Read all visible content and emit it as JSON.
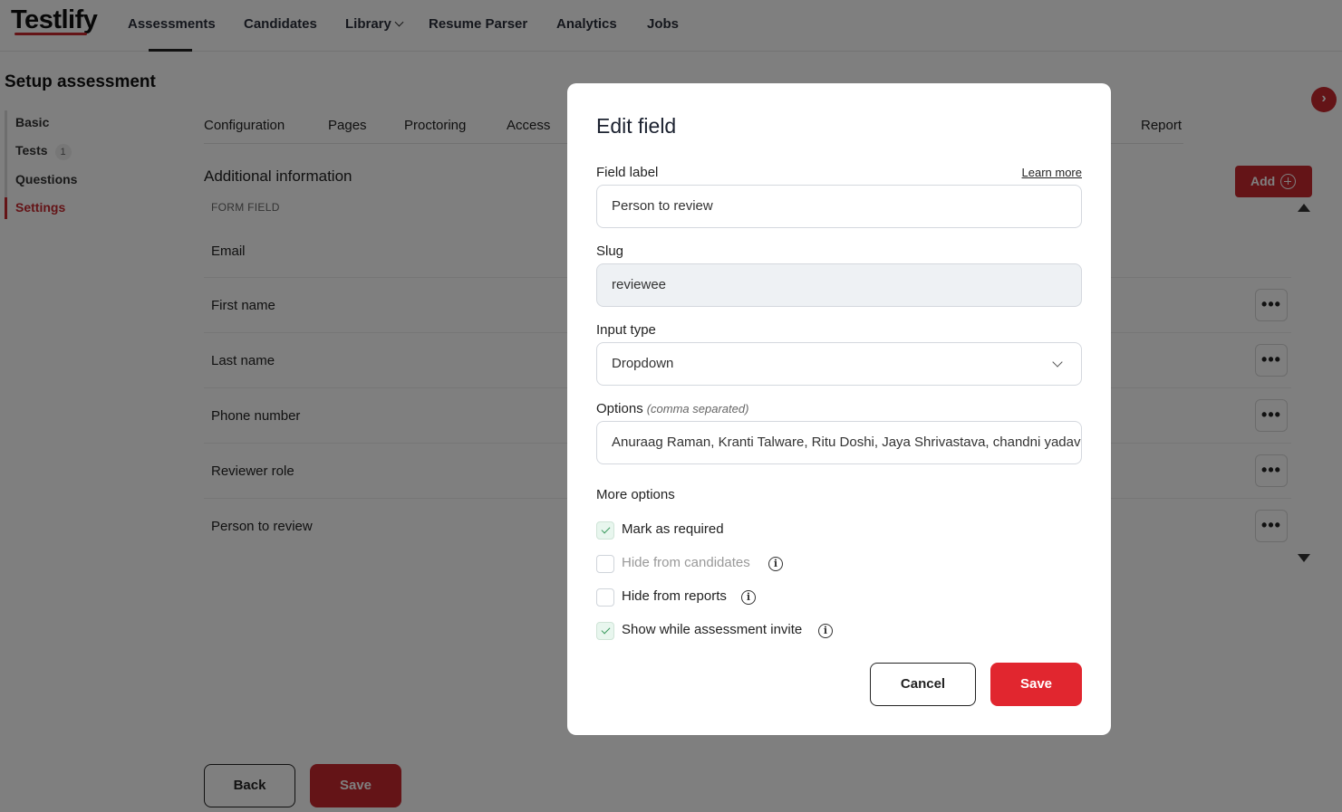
{
  "brand": {
    "logo": "Testlify",
    "accent": "#c8282f"
  },
  "nav": {
    "assessments": "Assessments",
    "candidates": "Candidates",
    "library": "Library",
    "resume_parser": "Resume Parser",
    "analytics": "Analytics",
    "jobs": "Jobs"
  },
  "page": {
    "title": "Setup assessment",
    "sidebar": {
      "basic": "Basic",
      "tests": "Tests",
      "tests_count": "1",
      "questions": "Questions",
      "settings": "Settings"
    },
    "tabs": {
      "configuration": "Configuration",
      "pages": "Pages",
      "proctoring": "Proctoring",
      "access": "Access",
      "report": "Report"
    },
    "section_title": "Additional information",
    "add_label": "Add",
    "form_field_header": "FORM FIELD",
    "rows": [
      "Email",
      "First name",
      "Last name",
      "Phone number",
      "Reviewer role",
      "Person to review"
    ],
    "more_icon": "•••",
    "next_icon": "›",
    "back_label": "Back",
    "save_label": "Save"
  },
  "modal": {
    "title": "Edit field",
    "field_label": "Field label",
    "learn_more": "Learn more",
    "field_label_value": "Person to review",
    "slug_label": "Slug",
    "slug_value": "reviewee",
    "input_type_label": "Input type",
    "input_type_value": "Dropdown",
    "options_label": "Options",
    "options_hint": "(comma separated)",
    "options_value": "Anuraag Raman, Kranti Talware, Ritu Doshi, Jaya Shrivastava, chandni yadav",
    "more_options": "More options",
    "checkboxes": {
      "required": {
        "label": "Mark as required",
        "checked": true
      },
      "hide_candidates": {
        "label": "Hide from candidates",
        "checked": false
      },
      "hide_reports": {
        "label": "Hide from reports",
        "checked": false
      },
      "show_invite": {
        "label": "Show while assessment invite",
        "checked": true
      }
    },
    "info_glyph": "i",
    "cancel_label": "Cancel",
    "save_label": "Save"
  }
}
